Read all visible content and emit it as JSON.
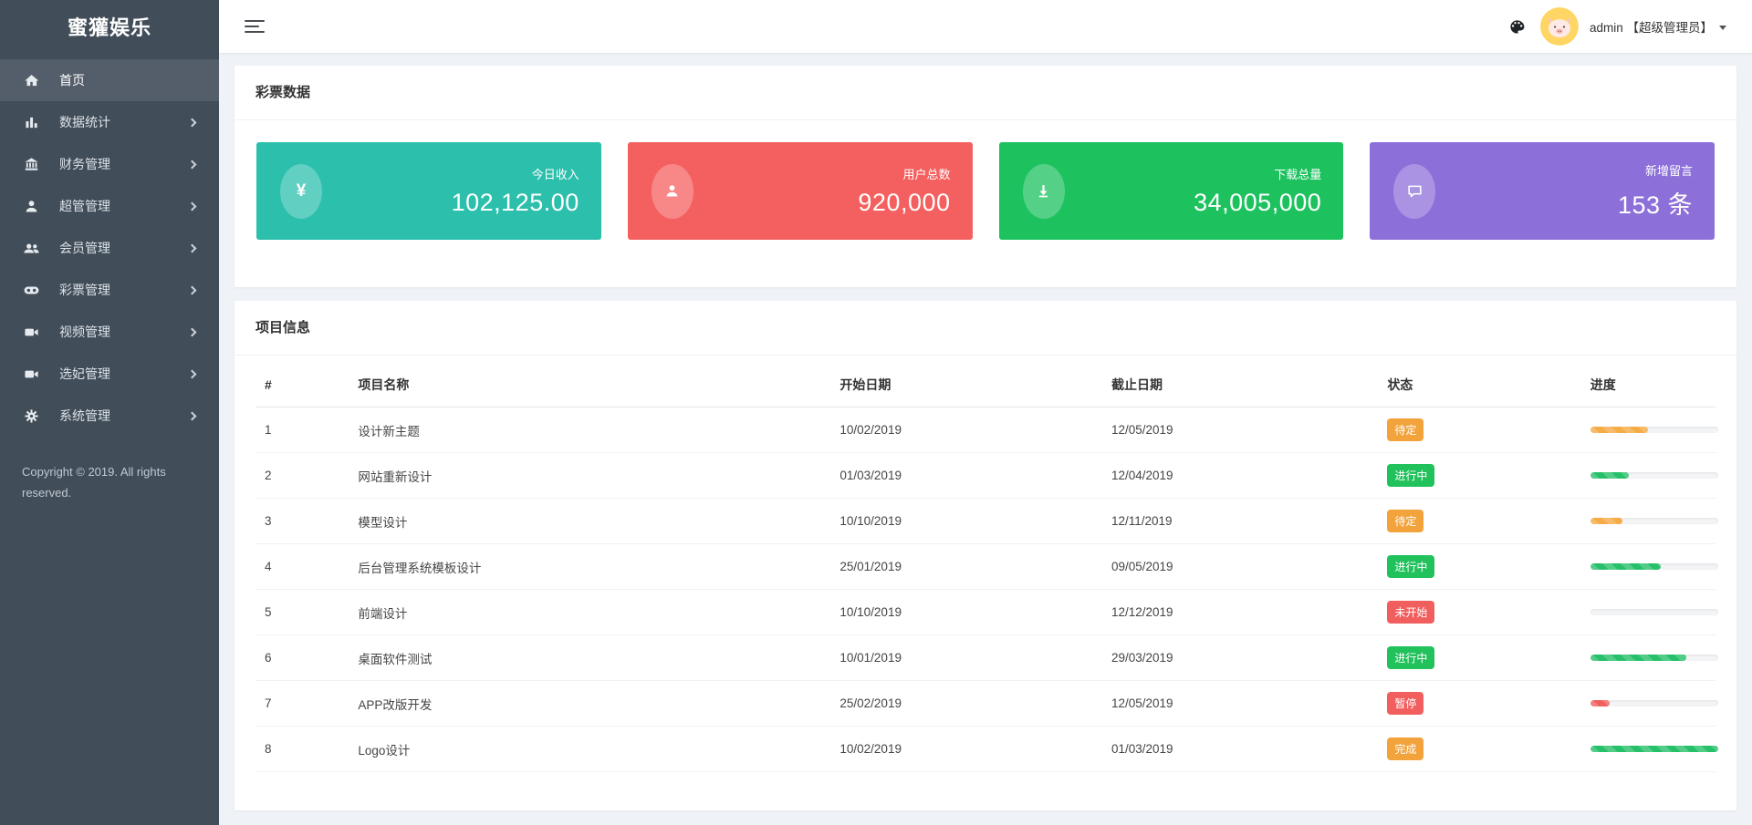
{
  "sidebar": {
    "logo": "蜜獾娱乐",
    "items": [
      {
        "key": "home",
        "label": "首页",
        "icon": "home-icon",
        "active": true,
        "has_submenu": false
      },
      {
        "key": "data-stats",
        "label": "数据统计",
        "icon": "bar-chart-icon",
        "active": false,
        "has_submenu": true
      },
      {
        "key": "finance",
        "label": "财务管理",
        "icon": "bank-icon",
        "active": false,
        "has_submenu": true
      },
      {
        "key": "super-admin",
        "label": "超管管理",
        "icon": "user-icon",
        "active": false,
        "has_submenu": true
      },
      {
        "key": "members",
        "label": "会员管理",
        "icon": "users-icon",
        "active": false,
        "has_submenu": true
      },
      {
        "key": "lottery",
        "label": "彩票管理",
        "icon": "gamepad-icon",
        "active": false,
        "has_submenu": true
      },
      {
        "key": "video",
        "label": "视频管理",
        "icon": "video-icon",
        "active": false,
        "has_submenu": true
      },
      {
        "key": "xuanfei",
        "label": "选妃管理",
        "icon": "video-icon",
        "active": false,
        "has_submenu": true
      },
      {
        "key": "system",
        "label": "系统管理",
        "icon": "gear-icon",
        "active": false,
        "has_submenu": true
      }
    ],
    "copyright": "Copyright © 2019. All rights reserved."
  },
  "header": {
    "menu_toggle_icon": "hamburger-icon",
    "theme_icon": "palette-icon",
    "avatar_icon": "pig-avatar",
    "username": "admin 【超级管理员】",
    "caret_icon": "caret-down-icon"
  },
  "stats_panel": {
    "title": "彩票数据",
    "cards": [
      {
        "key": "today-income",
        "icon": "yen-icon",
        "label": "今日收入",
        "value": "102,125.00",
        "color": "#2cbfac"
      },
      {
        "key": "total-users",
        "icon": "user-icon",
        "label": "用户总数",
        "value": "920,000",
        "color": "#f4605f"
      },
      {
        "key": "total-downloads",
        "icon": "download-icon",
        "label": "下载总量",
        "value": "34,005,000",
        "color": "#1dc25f"
      },
      {
        "key": "new-messages",
        "icon": "comment-icon",
        "label": "新增留言",
        "value": "153 条",
        "color": "#8d6fd9"
      }
    ]
  },
  "projects_panel": {
    "title": "项目信息",
    "columns": [
      "#",
      "项目名称",
      "开始日期",
      "截止日期",
      "状态",
      "进度"
    ],
    "rows": [
      {
        "id": "1",
        "name": "设计新主题",
        "start": "10/02/2019",
        "end": "12/05/2019",
        "status": "待定",
        "status_type": "orange",
        "progress": 45,
        "bar": "orange"
      },
      {
        "id": "2",
        "name": "网站重新设计",
        "start": "01/03/2019",
        "end": "12/04/2019",
        "status": "进行中",
        "status_type": "green",
        "progress": 30,
        "bar": "green"
      },
      {
        "id": "3",
        "name": "模型设计",
        "start": "10/10/2019",
        "end": "12/11/2019",
        "status": "待定",
        "status_type": "orange",
        "progress": 25,
        "bar": "orange"
      },
      {
        "id": "4",
        "name": "后台管理系统模板设计",
        "start": "25/01/2019",
        "end": "09/05/2019",
        "status": "进行中",
        "status_type": "green",
        "progress": 55,
        "bar": "green"
      },
      {
        "id": "5",
        "name": "前端设计",
        "start": "10/10/2019",
        "end": "12/12/2019",
        "status": "未开始",
        "status_type": "red",
        "progress": 0,
        "bar": "green"
      },
      {
        "id": "6",
        "name": "桌面软件测试",
        "start": "10/01/2019",
        "end": "29/03/2019",
        "status": "进行中",
        "status_type": "green",
        "progress": 75,
        "bar": "green"
      },
      {
        "id": "7",
        "name": "APP改版开发",
        "start": "25/02/2019",
        "end": "12/05/2019",
        "status": "暂停",
        "status_type": "red",
        "progress": 15,
        "bar": "red"
      },
      {
        "id": "8",
        "name": "Logo设计",
        "start": "10/02/2019",
        "end": "01/03/2019",
        "status": "完成",
        "status_type": "orange",
        "progress": 100,
        "bar": "green"
      }
    ]
  },
  "colors": {
    "sidebar_bg": "#414d59",
    "sidebar_active": "#545e6b",
    "page_bg": "#eff2f6",
    "badge_orange": "#f2a33c",
    "badge_green": "#21c15b",
    "badge_red": "#f15e5e",
    "bar_orange": "#f5ab46",
    "bar_green": "#27c06a",
    "bar_red": "#f0605f",
    "avatar_bg": "#ffd564"
  }
}
